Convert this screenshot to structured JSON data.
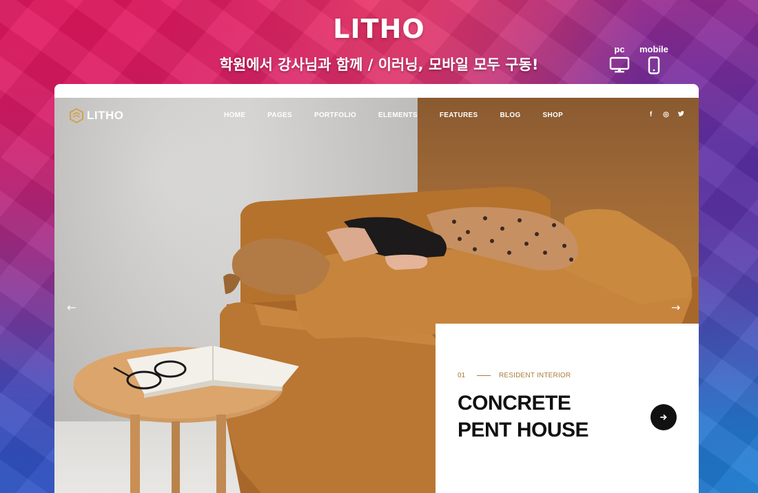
{
  "banner": {
    "title": "LITHO",
    "subtitle": "학원에서 강사님과 함께 / 이러닝, 모바일 모두 구동!",
    "devices": [
      {
        "label": "pc",
        "icon": "monitor-icon"
      },
      {
        "label": "mobile",
        "icon": "smartphone-icon"
      }
    ]
  },
  "site": {
    "logo_text": "LITHO",
    "nav": [
      "HOME",
      "PAGES",
      "PORTFOLIO",
      "ELEMENTS",
      "FEATURES",
      "BLOG",
      "SHOP"
    ],
    "social": [
      {
        "icon": "facebook-icon",
        "glyph": "f"
      },
      {
        "icon": "instagram-icon",
        "glyph": "◎"
      },
      {
        "icon": "twitter-icon",
        "glyph": "🐦"
      }
    ]
  },
  "slider": {
    "prev_arrow": "←",
    "next_arrow": "→",
    "slide": {
      "number": "01",
      "category": "RESIDENT INTERIOR",
      "title_line1": "CONCRETE",
      "title_line2": "PENT HOUSE",
      "button_icon": "arrow-right-icon"
    }
  },
  "colors": {
    "accent": "#a87b3b",
    "sofa": "#b8742f",
    "title": "#111111"
  }
}
